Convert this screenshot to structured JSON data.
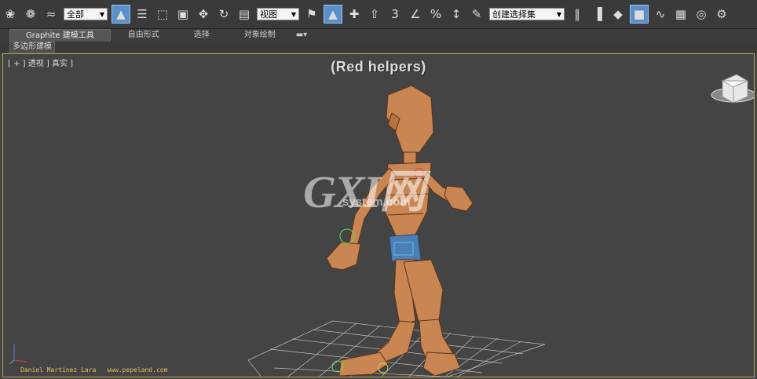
{
  "toolbar": {
    "filter_select": "全部",
    "refcoord_select": "视图",
    "angle_snap": "3",
    "percent_snap": "%",
    "named_selection": "创建选择集"
  },
  "ribbon": {
    "tabs": [
      {
        "label": "Graphite 建模工具"
      },
      {
        "label": "自由形式"
      },
      {
        "label": "选择"
      },
      {
        "label": "对象绘制"
      }
    ],
    "sub_tab": "多边形建模"
  },
  "viewport": {
    "label": "[ + ] 透视 ] 真实 ]",
    "title": "(Red helpers)",
    "credit_author": "Daniel Martinez Lara",
    "credit_site": "www.pepeland.com",
    "watermark_big": "GXI网",
    "watermark_small": "system.com"
  },
  "colors": {
    "viewport_bg": "#444444",
    "viewport_border": "#c8a24a",
    "character_skin": "#c98552",
    "shorts": "#4d7fb5",
    "grid": "#bfbfbf",
    "active_button": "#5b8fc7"
  }
}
